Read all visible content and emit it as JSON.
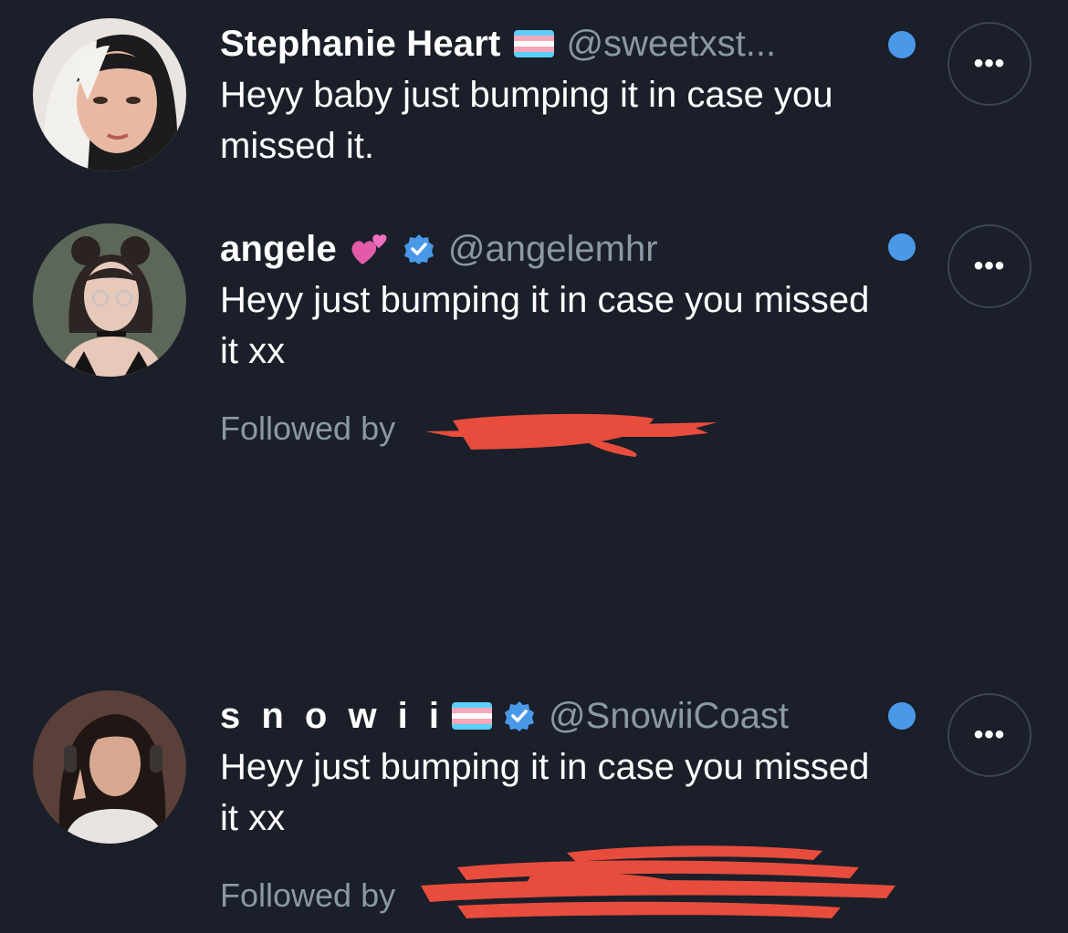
{
  "messages": [
    {
      "name": "Stephanie Heart",
      "flag_icon": "trans-flag-icon",
      "handle": "@sweetxst...",
      "text": "Heyy baby just bumping it in case you missed it.",
      "unread": true,
      "more_label": "•••"
    },
    {
      "name": "angele",
      "emoji_icon": "two-hearts-emoji-icon",
      "verified_icon": "verified-badge-icon",
      "handle": "@angelemhr",
      "text": "Heyy just bumping it in case you missed it xx",
      "followed_by": "Followed by",
      "unread": true,
      "more_label": "•••"
    },
    {
      "name": "s n o w i i",
      "flag_icon": "trans-flag-icon",
      "verified_icon": "verified-badge-icon",
      "handle": "@SnowiiCoast",
      "text": "Heyy just bumping it in case you missed it xx",
      "followed_by": "Followed by",
      "unread": true,
      "more_label": "•••"
    }
  ],
  "colors": {
    "background": "#1a1f29",
    "primary_text": "#ffffff",
    "secondary_text": "#8b98a5",
    "unread_dot": "#4a99e9",
    "verified_badge": "#4a99e9",
    "redaction": "#e84c3d"
  }
}
